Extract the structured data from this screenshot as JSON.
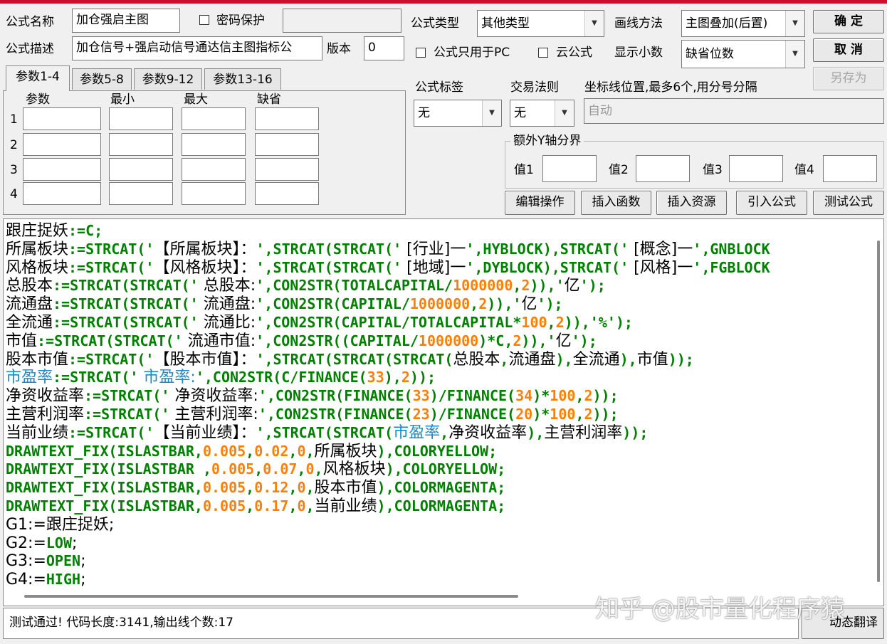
{
  "form": {
    "name_label": "公式名称",
    "name_value": "加仓强启主图",
    "password_label": "密码保护",
    "password_value": "",
    "desc_label": "公式描述",
    "desc_value": "加仓信号+强启动信号通达信主图指标公",
    "version_label": "版本",
    "version_value": "0",
    "type_label": "公式类型",
    "type_value": "其他类型",
    "draw_label": "画线方法",
    "draw_value": "主图叠加(后置)",
    "pc_only_label": "公式只用于PC",
    "cloud_label": "云公式",
    "decimals_label": "显示小数",
    "decimals_value": "缺省位数",
    "tag_label": "公式标签",
    "tag_value": "无",
    "rule_label": "交易法则",
    "rule_value": "无",
    "axis_label": "坐标线位置,最多6个,用分号分隔",
    "axis_placeholder": "自动",
    "yaxis_group_label": "额外Y轴分界",
    "yvals": [
      "值1",
      "值2",
      "值3",
      "值4"
    ]
  },
  "buttons": {
    "ok": "确  定",
    "cancel": "取  消",
    "save_as": "另存为",
    "edit": "编辑操作",
    "insert_func": "插入函数",
    "insert_res": "插入资源",
    "import": "引入公式",
    "test": "测试公式",
    "translate": "动态翻译"
  },
  "tabs": [
    "参数1-4",
    "参数5-8",
    "参数9-12",
    "参数13-16"
  ],
  "param_headers": [
    "参数",
    "最小",
    "最大",
    "缺省"
  ],
  "param_rows": [
    "1",
    "2",
    "3",
    "4"
  ],
  "code_lines": [
    [
      [
        "k",
        "跟庄捉妖"
      ],
      [
        "c",
        ":=C;"
      ]
    ],
    [
      [
        "k",
        "所属板块"
      ],
      [
        "c",
        ":=STRCAT('"
      ],
      [
        "k",
        "【所属板块】："
      ],
      [
        "c",
        "',STRCAT(STRCAT('"
      ],
      [
        "k",
        " [行业]一"
      ],
      [
        "c",
        "',HYBLOCK),STRCAT('"
      ],
      [
        "k",
        " [概念]一"
      ],
      [
        "c",
        "',GNBLOCK"
      ]
    ],
    [
      [
        "k",
        "风格板块"
      ],
      [
        "c",
        ":=STRCAT('"
      ],
      [
        "k",
        "【风格板块】："
      ],
      [
        "c",
        "',STRCAT(STRCAT('"
      ],
      [
        "k",
        " [地域]一"
      ],
      [
        "c",
        "',DYBLOCK),STRCAT('"
      ],
      [
        "k",
        " [风格]一"
      ],
      [
        "c",
        "',FGBLOCK"
      ]
    ],
    [
      [
        "k",
        "总股本"
      ],
      [
        "c",
        ":=STRCAT(STRCAT('"
      ],
      [
        "k",
        " 总股本:"
      ],
      [
        "c",
        "',CON2STR(TOTALCAPITAL/"
      ],
      [
        "n",
        "1000000"
      ],
      [
        "c",
        ","
      ],
      [
        "n",
        "2"
      ],
      [
        "c",
        ")),'"
      ],
      [
        "k",
        "亿"
      ],
      [
        "c",
        "');"
      ]
    ],
    [
      [
        "k",
        "流通盘"
      ],
      [
        "c",
        ":=STRCAT(STRCAT('"
      ],
      [
        "k",
        " 流通盘:"
      ],
      [
        "c",
        "',CON2STR(CAPITAL/"
      ],
      [
        "n",
        "1000000"
      ],
      [
        "c",
        ","
      ],
      [
        "n",
        "2"
      ],
      [
        "c",
        ")),'"
      ],
      [
        "k",
        "亿"
      ],
      [
        "c",
        "');"
      ]
    ],
    [
      [
        "k",
        "全流通"
      ],
      [
        "c",
        ":=STRCAT(STRCAT('"
      ],
      [
        "k",
        " 流通比:"
      ],
      [
        "c",
        "',CON2STR(CAPITAL/TOTALCAPITAL*"
      ],
      [
        "n",
        "100"
      ],
      [
        "c",
        ","
      ],
      [
        "n",
        "2"
      ],
      [
        "c",
        ")),'%');"
      ]
    ],
    [
      [
        "k",
        "市值"
      ],
      [
        "c",
        ":=STRCAT(STRCAT('"
      ],
      [
        "k",
        " 流通市值:"
      ],
      [
        "c",
        "',CON2STR((CAPITAL/"
      ],
      [
        "n",
        "1000000"
      ],
      [
        "c",
        ")*C,"
      ],
      [
        "n",
        "2"
      ],
      [
        "c",
        ")),'"
      ],
      [
        "k",
        "亿"
      ],
      [
        "c",
        "');"
      ]
    ],
    [
      [
        "k",
        "股本市值"
      ],
      [
        "c",
        ":=STRCAT('"
      ],
      [
        "k",
        "【股本市值】："
      ],
      [
        "c",
        "',STRCAT(STRCAT(STRCAT("
      ],
      [
        "k",
        "总股本"
      ],
      [
        "c",
        ","
      ],
      [
        "k",
        "流通盘"
      ],
      [
        "c",
        "),"
      ],
      [
        "k",
        "全流通"
      ],
      [
        "c",
        "),"
      ],
      [
        "k",
        "市值"
      ],
      [
        "c",
        "));"
      ]
    ],
    [
      [
        "b",
        "市盈率"
      ],
      [
        "c",
        ":=STRCAT('"
      ],
      [
        "b",
        " 市盈率:"
      ],
      [
        "c",
        "',CON2STR(C/FINANCE("
      ],
      [
        "n",
        "33"
      ],
      [
        "c",
        "),"
      ],
      [
        "n",
        "2"
      ],
      [
        "c",
        "));"
      ]
    ],
    [
      [
        "k",
        "净资收益率"
      ],
      [
        "c",
        ":=STRCAT('"
      ],
      [
        "k",
        " 净资收益率:"
      ],
      [
        "c",
        "',CON2STR(FINANCE("
      ],
      [
        "n",
        "33"
      ],
      [
        "c",
        ")/FINANCE("
      ],
      [
        "n",
        "34"
      ],
      [
        "c",
        ")*"
      ],
      [
        "n",
        "100"
      ],
      [
        "c",
        ","
      ],
      [
        "n",
        "2"
      ],
      [
        "c",
        "));"
      ]
    ],
    [
      [
        "k",
        "主营利润率"
      ],
      [
        "c",
        ":=STRCAT('"
      ],
      [
        "k",
        " 主营利润率:"
      ],
      [
        "c",
        "',CON2STR(FINANCE("
      ],
      [
        "n",
        "23"
      ],
      [
        "c",
        ")/FINANCE("
      ],
      [
        "n",
        "20"
      ],
      [
        "c",
        ")*"
      ],
      [
        "n",
        "100"
      ],
      [
        "c",
        ","
      ],
      [
        "n",
        "2"
      ],
      [
        "c",
        "));"
      ]
    ],
    [
      [
        "k",
        "当前业绩"
      ],
      [
        "c",
        ":=STRCAT('"
      ],
      [
        "k",
        "【当前业绩】："
      ],
      [
        "c",
        "',STRCAT(STRCAT("
      ],
      [
        "b",
        "市盈率"
      ],
      [
        "c",
        ","
      ],
      [
        "k",
        "净资收益率"
      ],
      [
        "c",
        "),"
      ],
      [
        "k",
        "主营利润率"
      ],
      [
        "c",
        "));"
      ]
    ],
    [
      [
        "c",
        "DRAWTEXT_FIX(ISLASTBAR,"
      ],
      [
        "n",
        "0.005"
      ],
      [
        "c",
        ","
      ],
      [
        "n",
        "0.02"
      ],
      [
        "c",
        ","
      ],
      [
        "n",
        "0"
      ],
      [
        "c",
        ","
      ],
      [
        "k",
        "所属板块"
      ],
      [
        "c",
        "),COLORYELLOW;"
      ]
    ],
    [
      [
        "c",
        "DRAWTEXT_FIX(ISLASTBAR ,"
      ],
      [
        "n",
        "0.005"
      ],
      [
        "c",
        ","
      ],
      [
        "n",
        "0.07"
      ],
      [
        "c",
        ","
      ],
      [
        "n",
        "0"
      ],
      [
        "c",
        ","
      ],
      [
        "k",
        "风格板块"
      ],
      [
        "c",
        "),COLORYELLOW;"
      ]
    ],
    [
      [
        "c",
        "DRAWTEXT_FIX(ISLASTBAR,"
      ],
      [
        "n",
        "0.005"
      ],
      [
        "c",
        ","
      ],
      [
        "n",
        "0.12"
      ],
      [
        "c",
        ","
      ],
      [
        "n",
        "0"
      ],
      [
        "c",
        ","
      ],
      [
        "k",
        "股本市值"
      ],
      [
        "c",
        "),COLORMAGENTA;"
      ]
    ],
    [
      [
        "c",
        "DRAWTEXT_FIX(ISLASTBAR,"
      ],
      [
        "n",
        "0.005"
      ],
      [
        "c",
        ","
      ],
      [
        "n",
        "0.17"
      ],
      [
        "c",
        ","
      ],
      [
        "n",
        "0"
      ],
      [
        "c",
        ","
      ],
      [
        "k",
        "当前业绩"
      ],
      [
        "c",
        "),COLORMAGENTA;"
      ]
    ],
    [
      [
        "k",
        "G1:="
      ],
      [
        "k",
        "跟庄捉妖;"
      ]
    ],
    [
      [
        "k",
        "G2:="
      ],
      [
        "c",
        "LOW"
      ],
      [
        "k",
        ";"
      ]
    ],
    [
      [
        "k",
        "G3:="
      ],
      [
        "c",
        "OPEN"
      ],
      [
        "k",
        ";"
      ]
    ],
    [
      [
        "k",
        "G4:="
      ],
      [
        "c",
        "HIGH"
      ],
      [
        "k",
        ";"
      ]
    ]
  ],
  "status_text": "测试通过! 代码长度:3141,输出线个数:17",
  "watermark": "知乎 @股市量化程序猿"
}
